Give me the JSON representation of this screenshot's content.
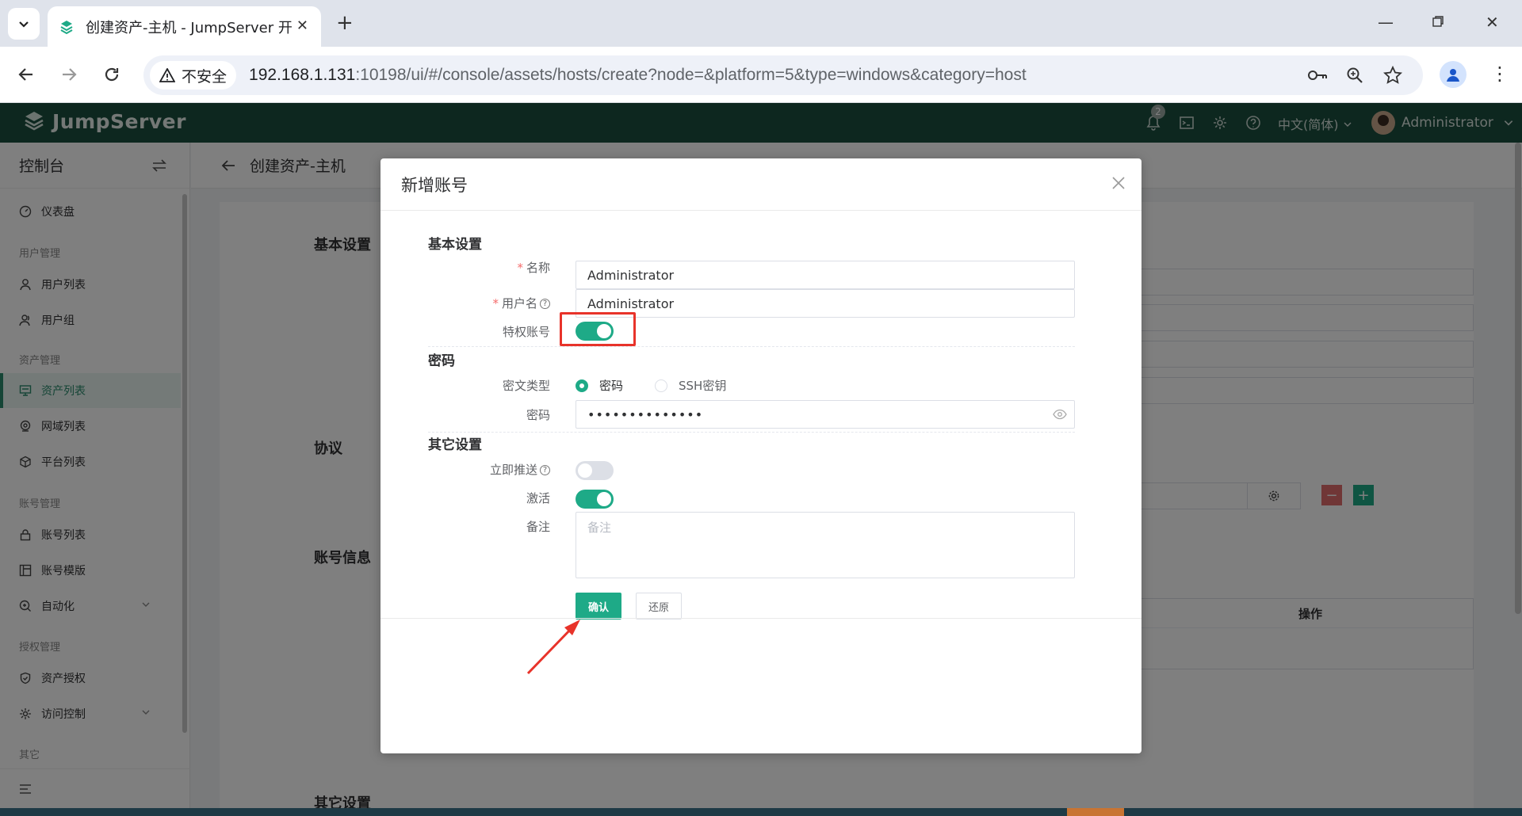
{
  "browser": {
    "tab_title": "创建资产-主机 - JumpServer 开",
    "security_label": "不安全",
    "url_host": "192.168.1.131",
    "url_rest": ":10198/ui/#/console/assets/hosts/create?node=&platform=5&type=windows&category=host"
  },
  "header": {
    "brand": "JumpServer",
    "notification_count": "2",
    "language": "中文(简体)",
    "username": "Administrator"
  },
  "sidebar": {
    "title": "控制台",
    "dashboard": "仪表盘",
    "groups": {
      "user": "用户管理",
      "asset": "资产管理",
      "account": "账号管理",
      "perm": "授权管理",
      "other": "其它"
    },
    "items": {
      "user_list": "用户列表",
      "user_group": "用户组",
      "asset_list": "资产列表",
      "zone_list": "网域列表",
      "platform_list": "平台列表",
      "account_list": "账号列表",
      "account_template": "账号模版",
      "automation": "自动化",
      "asset_perm": "资产授权",
      "access_control": "访问控制"
    }
  },
  "page": {
    "title": "创建资产-主机",
    "sections": {
      "basic": "基本设置",
      "protocol": "协议",
      "account_info": "账号信息",
      "other": "其它设置"
    },
    "table_action_header": "操作"
  },
  "modal": {
    "title": "新增账号",
    "sections": {
      "basic": "基本设置",
      "password": "密码",
      "other": "其它设置"
    },
    "fields": {
      "name_label": "名称",
      "name_value": "Administrator",
      "username_label": "用户名",
      "username_value": "Administrator",
      "privileged_label": "特权账号",
      "secret_type_label": "密文类型",
      "secret_type_password": "密码",
      "secret_type_ssh": "SSH密钥",
      "password_label": "密码",
      "password_value": "••••••••••••••",
      "push_now_label": "立即推送",
      "active_label": "激活",
      "comment_label": "备注",
      "comment_placeholder": "备注"
    },
    "state": {
      "privileged": true,
      "push_now": false,
      "active": true,
      "secret_type": "password"
    },
    "buttons": {
      "confirm": "确认",
      "reset": "还原"
    }
  },
  "colors": {
    "primary": "#1eaa87",
    "header_bg": "#1a4f3e",
    "highlight": "#e8332a"
  }
}
